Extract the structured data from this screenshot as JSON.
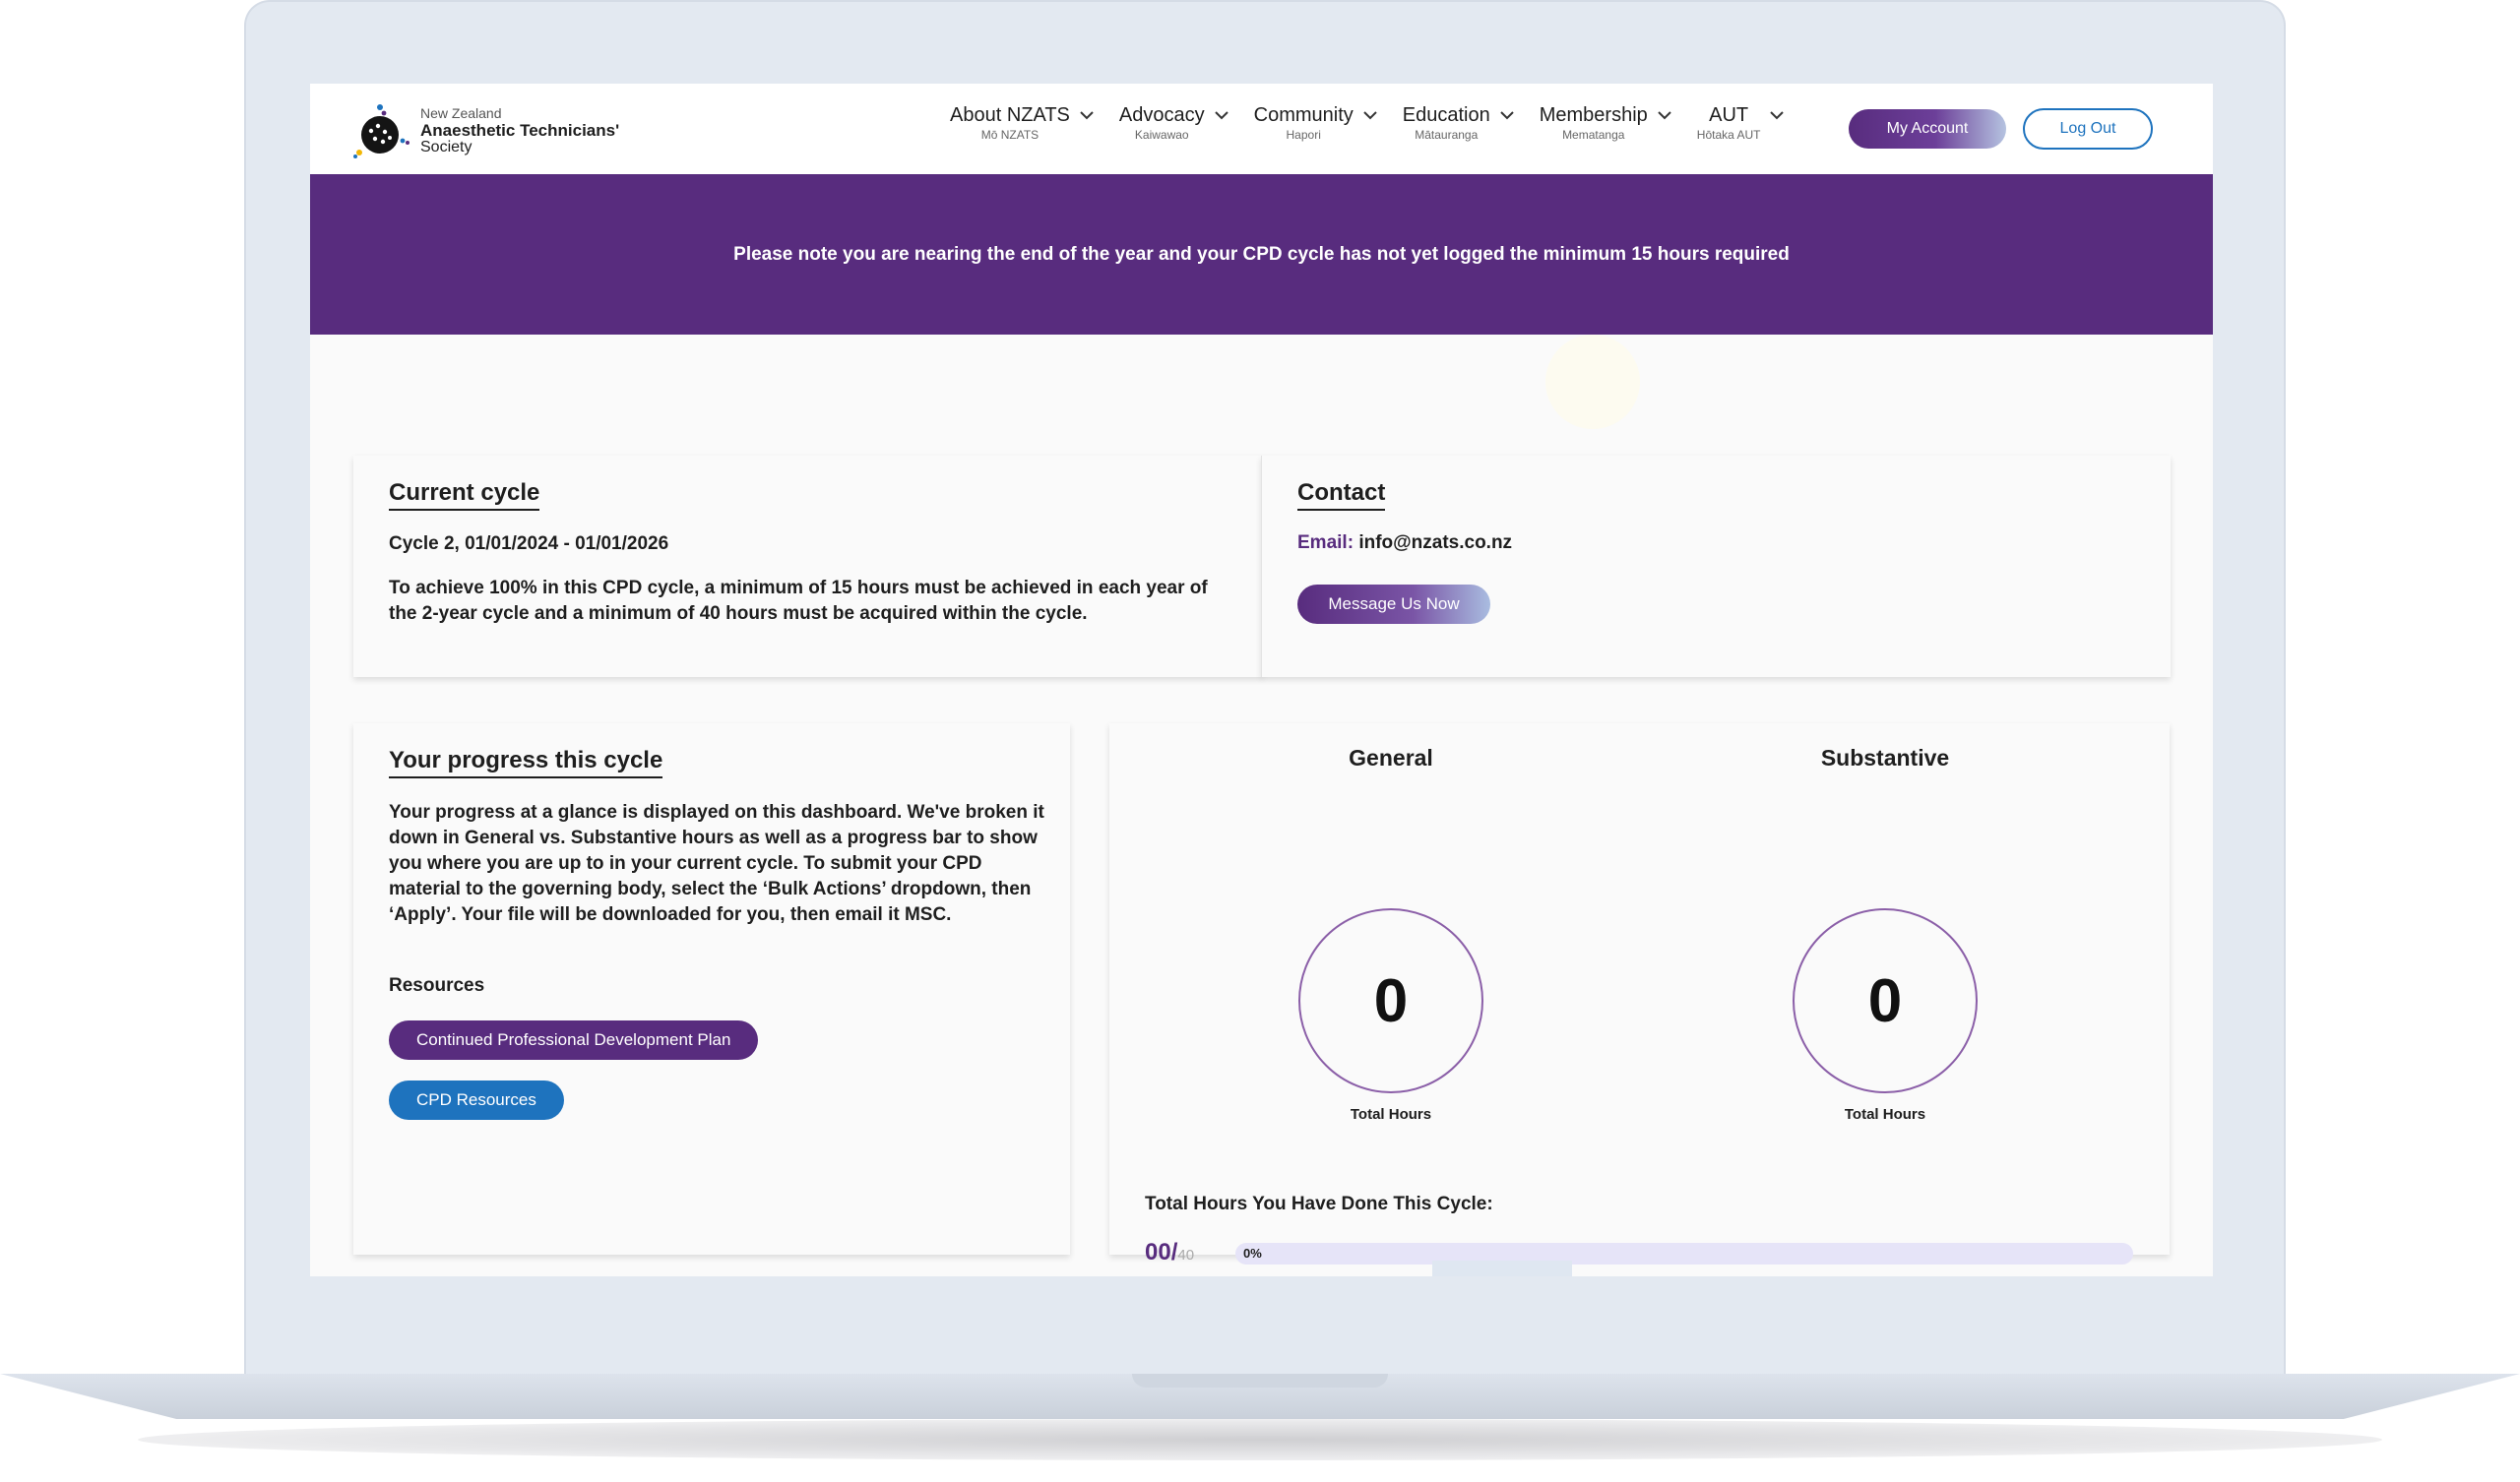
{
  "logo": {
    "line1": "New Zealand",
    "line2": "Anaesthetic Technicians'",
    "line3": "Society"
  },
  "nav": [
    {
      "label": "About NZATS",
      "sub": "Mō NZATS"
    },
    {
      "label": "Advocacy",
      "sub": "Kaiwawao"
    },
    {
      "label": "Community",
      "sub": "Hapori"
    },
    {
      "label": "Education",
      "sub": "Mātauranga"
    },
    {
      "label": "Membership",
      "sub": "Mematanga"
    },
    {
      "label": "AUT",
      "sub": "Hōtaka AUT"
    }
  ],
  "header": {
    "account_label": "My Account",
    "logout_label": "Log Out"
  },
  "banner": {
    "text": "Please note you are nearing the end of the year and your CPD cycle has not yet logged the minimum 15 hours required"
  },
  "cycle": {
    "title": "Current cycle",
    "period": "Cycle 2, 01/01/2024 - 01/01/2026",
    "description": "To achieve 100% in this CPD cycle, a minimum of 15 hours must be achieved in each year of the 2-year cycle and a minimum of 40 hours must be acquired within the cycle."
  },
  "contact": {
    "title": "Contact",
    "email_label": "Email:",
    "email": "info@nzats.co.nz",
    "button_label": "Message Us Now"
  },
  "progress": {
    "title": "Your progress this cycle",
    "description": "Your progress at a glance is displayed on this dashboard. We've broken it down in General vs. Substantive hours as well as a progress bar to show you where you are up to in your current cycle. To submit your CPD material to the governing body, select the ‘Bulk Actions’ dropdown, then ‘Apply’. Your file will be downloaded for you, then email it MSC.",
    "resources_label": "Resources",
    "resource_buttons": [
      "Continued Professional Development Plan",
      "CPD Resources"
    ]
  },
  "stats": {
    "general": {
      "title": "General",
      "value": "0",
      "caption": "Total Hours"
    },
    "substantive": {
      "title": "Substantive",
      "value": "0",
      "caption": "Total Hours"
    },
    "total_label": "Total Hours You Have Done This Cycle:",
    "done": "00/",
    "max": "40",
    "percent_label": "0%",
    "percent": 0
  },
  "colors": {
    "brand_purple": "#582c7e",
    "link_blue": "#1e73be",
    "ring": "#8b5fa8",
    "bar_track": "#e6e4f8"
  }
}
